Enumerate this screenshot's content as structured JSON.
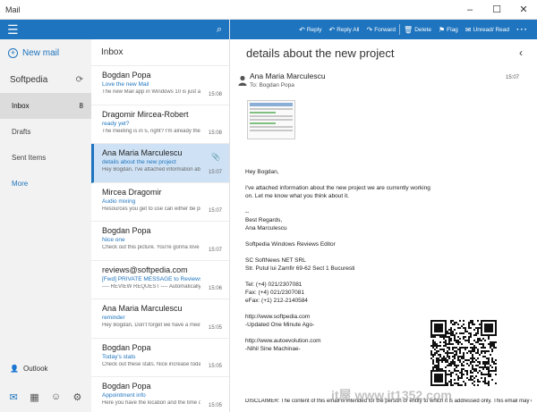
{
  "window": {
    "title": "Mail",
    "controls": [
      "–",
      "☐",
      "✕"
    ]
  },
  "colors": {
    "accent": "#1e74be",
    "selected_bg": "#cfe2f5"
  },
  "nav": {
    "new_mail": "New mail",
    "account": "Softpedia",
    "folders": [
      {
        "label": "Inbox",
        "count": "8"
      },
      {
        "label": "Drafts",
        "count": ""
      },
      {
        "label": "Sent Items",
        "count": ""
      }
    ],
    "more": "More",
    "outlook": "Outlook",
    "bottom_icons": [
      "mail-icon",
      "calendar-icon",
      "feedback-icon",
      "settings-icon"
    ]
  },
  "list": {
    "title": "Inbox",
    "messages": [
      {
        "from": "Bogdan Popa",
        "subject": "Love the new Mail",
        "preview": "The new Mail app in Windows 10 is just aw",
        "time": "15:08",
        "selected": false,
        "attachment": false
      },
      {
        "from": "Dragomir Mircea-Robert",
        "subject": "ready yet?",
        "preview": "The meeting is in 5, right? I'm already ther",
        "time": "15:08",
        "selected": false,
        "attachment": false
      },
      {
        "from": "Ana Maria Marculescu",
        "subject": "details about the new project",
        "preview": "Hey Bogdan, I've attached information abo",
        "time": "15:07",
        "selected": true,
        "attachment": true
      },
      {
        "from": "Mircea Dragomir",
        "subject": "Audio mixing",
        "preview": "Resources you get to use can either be pr",
        "time": "15:07",
        "selected": false,
        "attachment": false
      },
      {
        "from": "Bogdan Popa",
        "subject": "Nice one",
        "preview": "Check out this picture. You're gonna love",
        "time": "15:07",
        "selected": false,
        "attachment": false
      },
      {
        "from": "reviews@softpedia.com",
        "subject": "[Fwd] PRIVATE MESSAGE to Reviews from",
        "preview": "---- REVIEW REQUEST ---- Automatically for",
        "time": "15:06",
        "selected": false,
        "attachment": false
      },
      {
        "from": "Ana Maria Marculescu",
        "subject": "reminder",
        "preview": "Hey Bogdan, Don't forget we have a meet",
        "time": "15:05",
        "selected": false,
        "attachment": false
      },
      {
        "from": "Bogdan Popa",
        "subject": "Today's stats",
        "preview": "Check out these stats. Nice increase toda",
        "time": "15:05",
        "selected": false,
        "attachment": false
      },
      {
        "from": "Bogdan Popa",
        "subject": "Appointment info",
        "preview": "Here you have the location and the time o",
        "time": "15:05",
        "selected": false,
        "attachment": false
      }
    ]
  },
  "toolbar": {
    "reply": "Reply",
    "reply_all": "Reply All",
    "forward": "Forward",
    "delete": "Delete",
    "flag": "Flag",
    "unread_read": "Unread/ Read",
    "more": "···"
  },
  "reading": {
    "subject": "details about the new project",
    "sender": "Ana Maria Marculescu",
    "to": "To: Bogdan Popa",
    "time": "15:07",
    "body": {
      "greeting": "Hey Bogdan,",
      "line1": "I've attached information about the new project we are currently working",
      "line2": "on. Let me know what you think about it.",
      "sig_sep": "--",
      "regards": "Best Regards,",
      "name": "Ana Marculescu",
      "role": "Softpedia Windows Reviews Editor",
      "company": "SC SoftNews NET SRL",
      "address": "Str. Putul lui Zamfir 69-62 Sect 1 Bucuresti",
      "tel": "Tel: (+4) 021/2307081",
      "fax": "Fax: (+4) 021/2307081",
      "efax": "eFax: (+1) 212-2140584",
      "url1": "http://www.softpedia.com",
      "tag1": "-Updated One Minute Ago-",
      "url2": "http://www.autoevolution.com",
      "tag2": "-Nihil Sine Machinae-",
      "disclaimer": "DISCLAIMER: The content of this email is intended for the person or entity to which it is addressed only. This email may contain confidential information."
    },
    "watermark": "it屋 www.it1352.com"
  }
}
